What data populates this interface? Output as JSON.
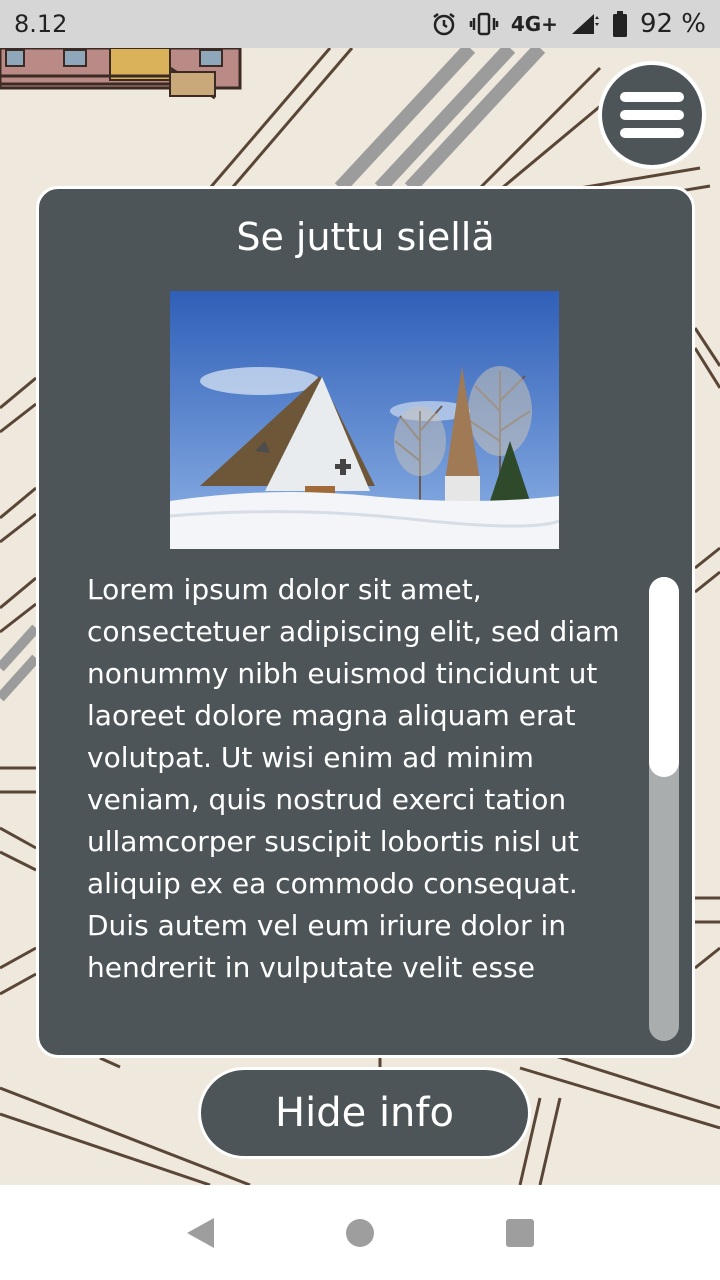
{
  "status_bar": {
    "time": "8.12",
    "network": "4G+",
    "battery_percent": "92 %",
    "icons": [
      "alarm-icon",
      "vibrate-icon",
      "signal-icon",
      "battery-icon"
    ]
  },
  "menu": {
    "icon": "hamburger-icon"
  },
  "info_card": {
    "title": "Se juttu siellä",
    "image": {
      "description_icon": "church-photo"
    },
    "body": "Lorem ipsum dolor sit amet, consectetuer adipiscing elit, sed diam nonummy nibh euismod tincidunt ut laoreet dolore magna aliquam erat volutpat. Ut wisi enim ad minim veniam, quis nostrud exerci tation ullamcorper suscipit lobortis nisl ut aliquip ex ea commodo consequat. Duis autem vel eum iriure dolor in hendrerit in vulputate velit esse molestie consequat.",
    "scroll_position": 0.0
  },
  "hide_button": {
    "label": "Hide info"
  },
  "nav_bar": {
    "buttons": [
      "back-icon",
      "home-icon",
      "recents-icon"
    ]
  },
  "colors": {
    "panel": "#4d5558",
    "map_background": "#efe8dc",
    "road_outline": "#5a4636",
    "rail": "#9c9c9c"
  }
}
